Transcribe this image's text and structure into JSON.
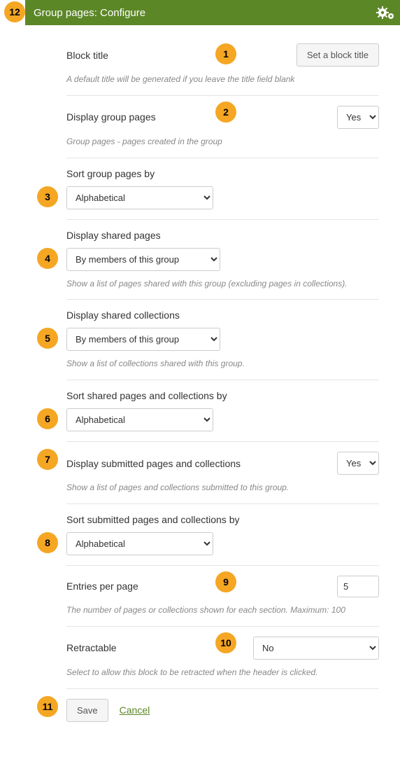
{
  "header": {
    "title": "Group pages: Configure",
    "close": "×"
  },
  "fields": {
    "block_title": {
      "label": "Block title",
      "button": "Set a block title",
      "help": "A default title will be generated if you leave the title field blank"
    },
    "display_group_pages": {
      "label": "Display group pages",
      "value": "Yes",
      "help": "Group pages - pages created in the group"
    },
    "sort_group_pages": {
      "label": "Sort group pages by",
      "value": "Alphabetical"
    },
    "display_shared_pages": {
      "label": "Display shared pages",
      "value": "By members of this group",
      "help": "Show a list of pages shared with this group (excluding pages in collections)."
    },
    "display_shared_collections": {
      "label": "Display shared collections",
      "value": "By members of this group",
      "help": "Show a list of collections shared with this group."
    },
    "sort_shared": {
      "label": "Sort shared pages and collections by",
      "value": "Alphabetical"
    },
    "display_submitted": {
      "label": "Display submitted pages and collections",
      "value": "Yes",
      "help": "Show a list of pages and collections submitted to this group."
    },
    "sort_submitted": {
      "label": "Sort submitted pages and collections by",
      "value": "Alphabetical"
    },
    "entries_per_page": {
      "label": "Entries per page",
      "value": "5",
      "help": "The number of pages or collections shown for each section. Maximum: 100"
    },
    "retractable": {
      "label": "Retractable",
      "value": "No",
      "help": "Select to allow this block to be retracted when the header is clicked."
    }
  },
  "actions": {
    "save": "Save",
    "cancel": "Cancel"
  },
  "markers": {
    "m1": "1",
    "m2": "2",
    "m3": "3",
    "m4": "4",
    "m5": "5",
    "m6": "6",
    "m7": "7",
    "m8": "8",
    "m9": "9",
    "m10": "10",
    "m11": "11",
    "m12": "12"
  }
}
